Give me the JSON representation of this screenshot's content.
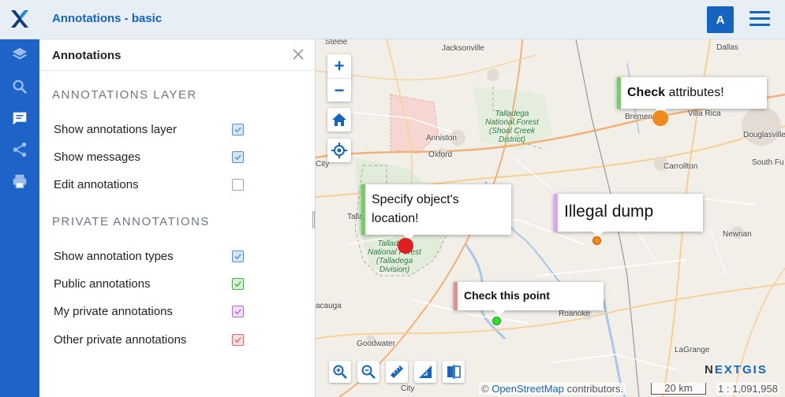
{
  "header": {
    "title": "Annotations - basic",
    "avatar_letter": "A",
    "logo_icon": "nextgis-x-logo",
    "menu_icon": "hamburger-menu-icon",
    "background": "#e8eef6",
    "accent": "#1565c0"
  },
  "leftnav": {
    "items": [
      {
        "name": "layers",
        "icon": "layers-icon",
        "active": false
      },
      {
        "name": "search",
        "icon": "search-icon",
        "active": false
      },
      {
        "name": "annotations",
        "icon": "chat-icon",
        "active": true
      },
      {
        "name": "share",
        "icon": "share-icon",
        "active": false
      },
      {
        "name": "print",
        "icon": "print-icon",
        "active": false
      }
    ],
    "background": "#1e64c8"
  },
  "panel": {
    "title": "Annotations",
    "close_icon": "close-icon",
    "section_layer": "ANNOTATIONS LAYER",
    "layer_rows": [
      {
        "label": "Show annotations layer",
        "checked": true,
        "color": "#5b8fd6"
      },
      {
        "label": "Show messages",
        "checked": true,
        "color": "#5b8fd6"
      },
      {
        "label": "Edit annotations",
        "checked": false,
        "color": "#5b8fd6"
      }
    ],
    "section_private": "PRIVATE ANNOTATIONS",
    "private_rows": [
      {
        "label": "Show annotation types",
        "checked": true,
        "color": "#5b8fd6"
      },
      {
        "label": "Public annotations",
        "checked": true,
        "color": "#4caf50"
      },
      {
        "label": "My private annotations",
        "checked": true,
        "color": "#b070d0"
      },
      {
        "label": "Other private annotations",
        "checked": true,
        "color": "#e07070"
      }
    ]
  },
  "map": {
    "places": [
      "Steele",
      "Jacksonville",
      "Anniston",
      "Oxford",
      "Bremen",
      "Villa Rica",
      "Carrollton",
      "South Fu",
      "Dallas",
      "Douglasville",
      "City",
      "Talla",
      "Newnan",
      "Roanoke",
      "Goodwater",
      "LaGrange",
      "acauga",
      "City"
    ],
    "forest_labels": [
      "Talladega National Forest (Shoal Creek District)",
      "Talladega National Forest (Talladega Division)"
    ],
    "annotations": [
      {
        "bold": "Check",
        "text": " attributes!",
        "bar_color": "#7bc96f",
        "marker_color": "#f08a1c"
      },
      {
        "bold": "",
        "text": "Specify object's location!",
        "bar_color": "#7bc96f",
        "marker_color": "#e02020"
      },
      {
        "bold": "",
        "text": "Illegal dump",
        "bar_color": "#d6a8f0",
        "marker_color": "#f08a1c"
      },
      {
        "bold": "Check this point",
        "text": "",
        "bar_color": "#f08b8b",
        "marker_color": "#33dd33"
      }
    ],
    "controls": {
      "zoom_in": "+",
      "zoom_out": "−",
      "home_icon": "home-icon",
      "locate_icon": "locate-icon"
    },
    "tools": [
      "zoom-in-tool-icon",
      "zoom-out-tool-icon",
      "measure-distance-icon",
      "measure-area-icon",
      "swipe-compare-icon"
    ],
    "brand": {
      "part1": "N",
      "part2": "EXTGIS"
    },
    "attribution": {
      "prefix": "© ",
      "link": "OpenStreetMap",
      "suffix": " contributors."
    },
    "scale_label": "20 km",
    "scale_ratio": "1 : 1,091,958"
  }
}
